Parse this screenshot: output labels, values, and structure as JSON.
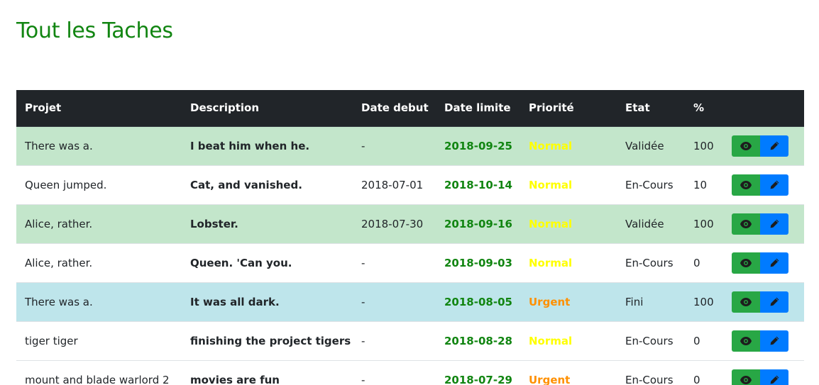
{
  "page": {
    "title": "Tout les Taches"
  },
  "table": {
    "headers": [
      "Projet",
      "Description",
      "Date debut",
      "Date limite",
      "Priorité",
      "Etat",
      "%",
      ""
    ],
    "rows": [
      {
        "project": "There was a.",
        "description": "I beat him when he.",
        "start": "-",
        "deadline": "2018-09-25",
        "priority": "Normal",
        "status": "Validée",
        "percent": "100",
        "variant": "success"
      },
      {
        "project": "Queen jumped.",
        "description": "Cat, and vanished.",
        "start": "2018-07-01",
        "deadline": "2018-10-14",
        "priority": "Normal",
        "status": "En-Cours",
        "percent": "10",
        "variant": "default"
      },
      {
        "project": "Alice, rather.",
        "description": "Lobster.",
        "start": "2018-07-30",
        "deadline": "2018-09-16",
        "priority": "Normal",
        "status": "Validée",
        "percent": "100",
        "variant": "success"
      },
      {
        "project": "Alice, rather.",
        "description": "Queen. 'Can you.",
        "start": "-",
        "deadline": "2018-09-03",
        "priority": "Normal",
        "status": "En-Cours",
        "percent": "0",
        "variant": "default"
      },
      {
        "project": "There was a.",
        "description": "It was all dark.",
        "start": "-",
        "deadline": "2018-08-05",
        "priority": "Urgent",
        "status": "Fini",
        "percent": "100",
        "variant": "info"
      },
      {
        "project": "tiger tiger",
        "description": "finishing the project tigers",
        "start": "-",
        "deadline": "2018-08-28",
        "priority": "Normal",
        "status": "En-Cours",
        "percent": "0",
        "variant": "default"
      },
      {
        "project": "mount and blade warlord 2",
        "description": "movies are fun",
        "start": "-",
        "deadline": "2018-07-29",
        "priority": "Urgent",
        "status": "En-Cours",
        "percent": "0",
        "variant": "default"
      }
    ],
    "actions": {
      "view_icon": "eye-icon",
      "edit_icon": "pencil-icon"
    }
  },
  "colors": {
    "title": "#118511",
    "header_bg": "#212529",
    "row_success": "#c3e6cb",
    "row_info": "#bee5eb",
    "deadline": "#118511",
    "priority_normal": "#ffff00",
    "priority_urgent": "#ff9000",
    "view_button": "#28a745",
    "edit_button": "#007bff"
  }
}
